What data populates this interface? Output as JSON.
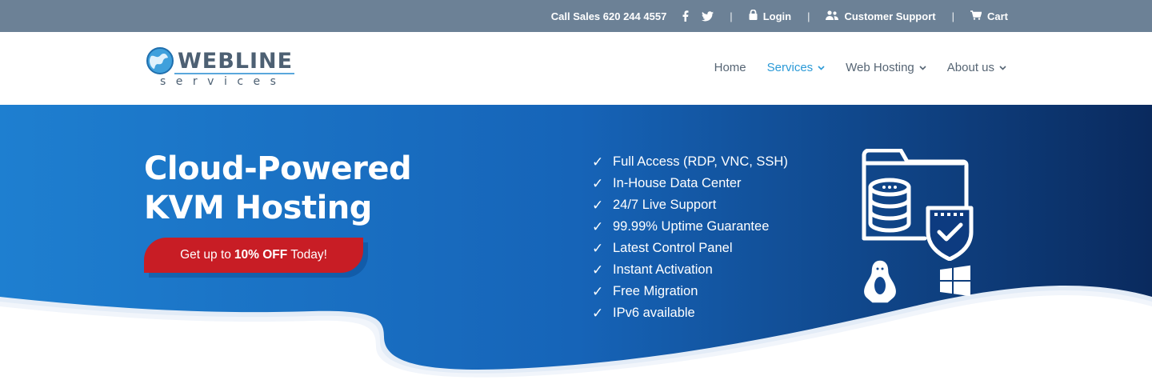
{
  "topbar": {
    "call_sales": "Call Sales 620 244 4557",
    "social": [
      "facebook-icon",
      "twitter-icon"
    ],
    "separator": "|",
    "login": "Login",
    "support": "Customer Support",
    "cart": "Cart"
  },
  "logo": {
    "main": "WEBLINE",
    "sub": "services"
  },
  "nav": {
    "items": [
      {
        "label": "Home",
        "dropdown": false,
        "active": false
      },
      {
        "label": "Services",
        "dropdown": true,
        "active": true
      },
      {
        "label": "Web Hosting",
        "dropdown": true,
        "active": false
      },
      {
        "label": "About us",
        "dropdown": true,
        "active": false
      }
    ]
  },
  "hero": {
    "title_line1": "Cloud-Powered",
    "title_line2": "KVM Hosting",
    "promo_prefix": "Get up to",
    "promo_bold": "10% OFF",
    "promo_suffix": "Today!",
    "check_glyph": "✓",
    "features": [
      "Full Access (RDP, VNC, SSH)",
      "In-House Data Center",
      "24/7 Live Support",
      "99.99% Uptime Guarantee",
      "Latest Control Panel",
      "Instant Activation",
      "Free Migration",
      "IPv6 available"
    ]
  },
  "colors": {
    "topbar": "#6c8196",
    "accent": "#2b9ad7",
    "hero_start": "#1e7fd0",
    "hero_end": "#0a2a5e",
    "promo": "#c81d25"
  },
  "icons": [
    "lock-icon",
    "users-icon",
    "cart-icon",
    "server-shield-icon",
    "linux-icon",
    "windows-icon"
  ]
}
